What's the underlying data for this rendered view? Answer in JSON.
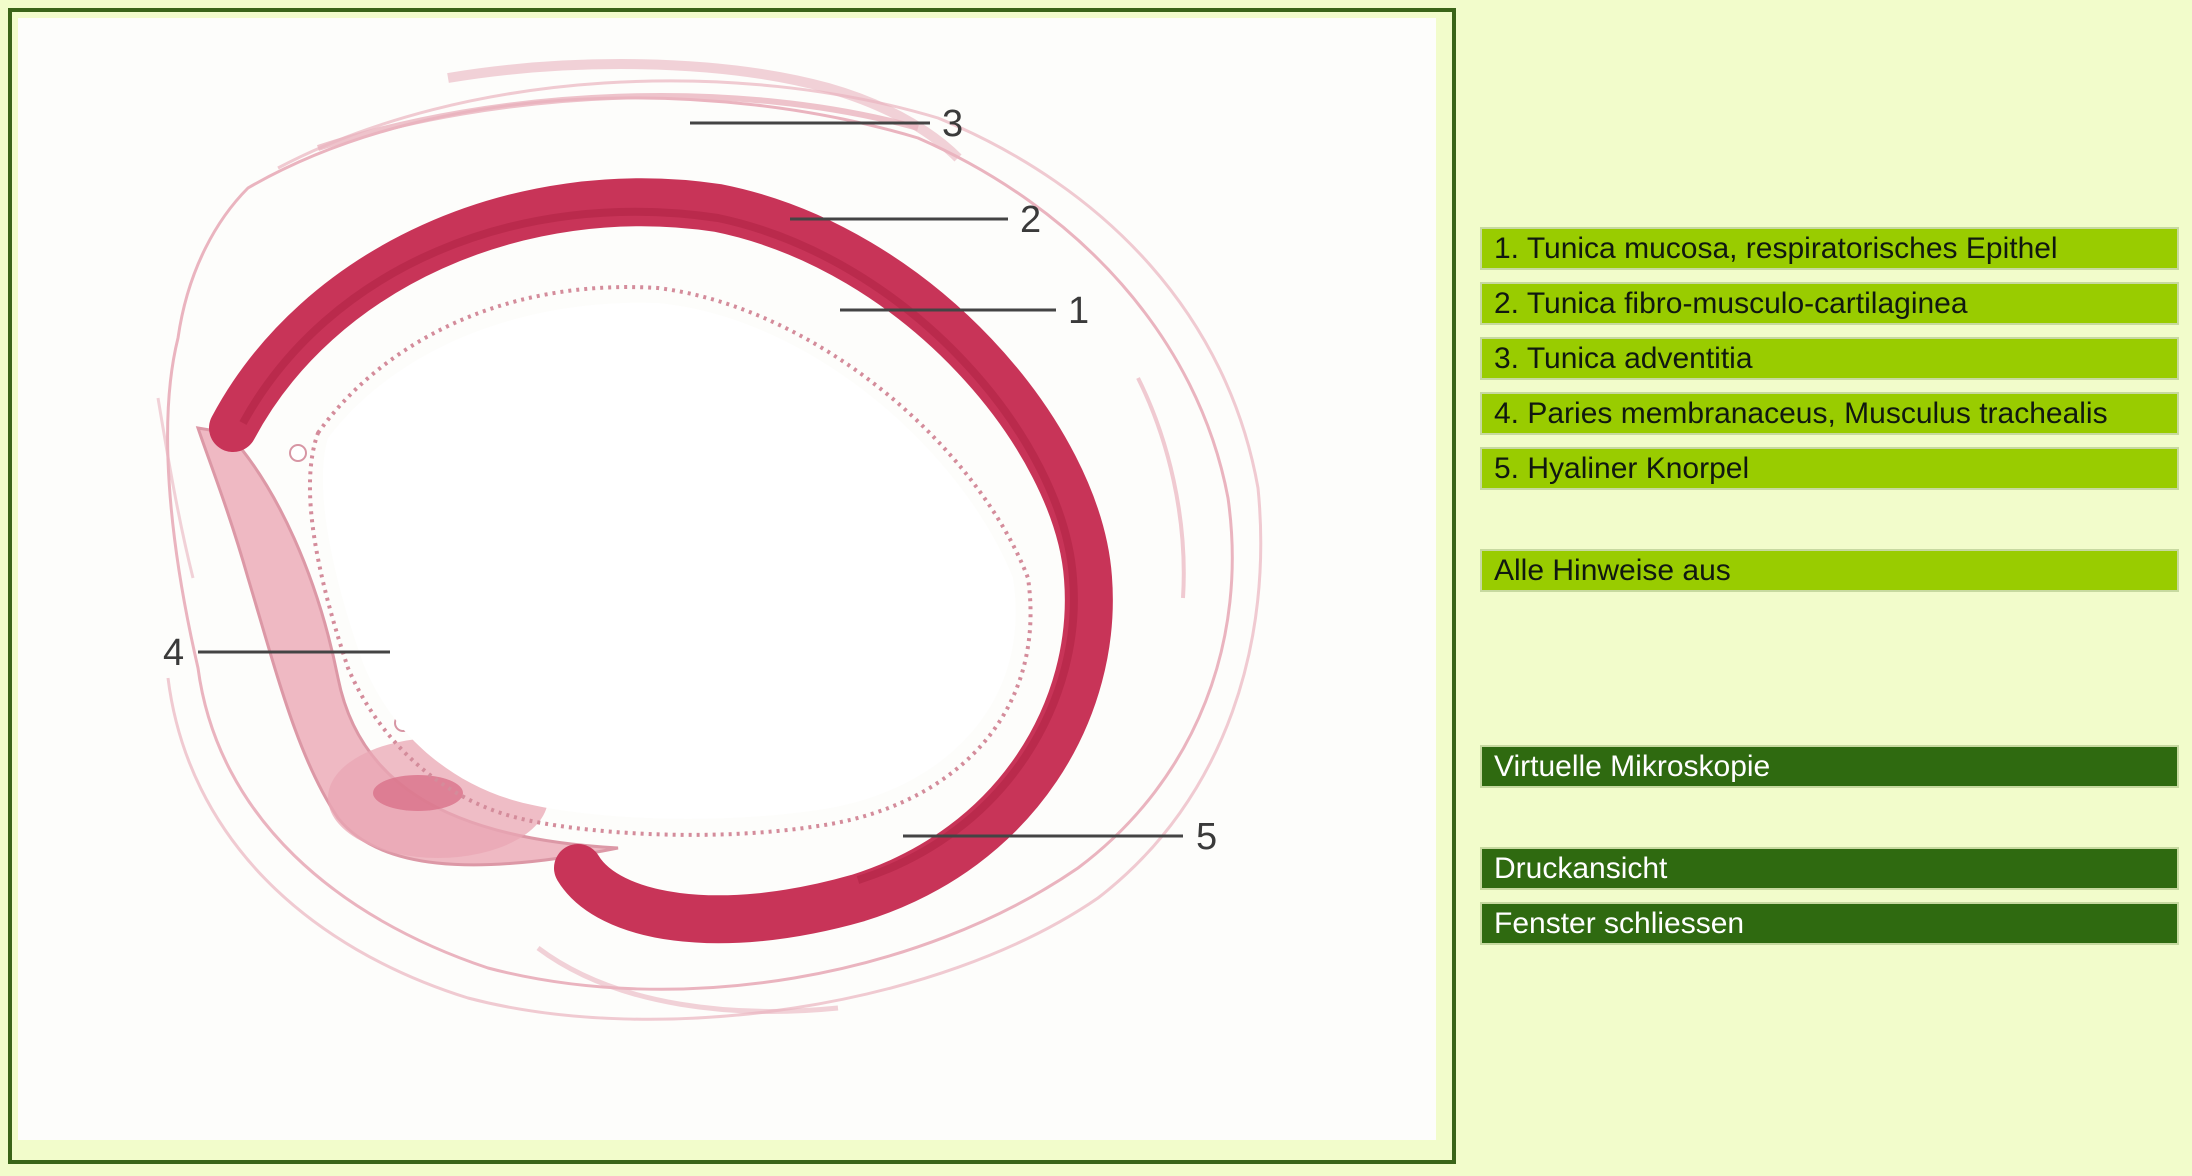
{
  "figure": {
    "labels": [
      "1",
      "2",
      "3",
      "4",
      "5"
    ]
  },
  "sidebar": {
    "legend": [
      "1. Tunica mucosa, respiratorisches Epithel",
      "2. Tunica fibro-musculo-cartilaginea",
      "3. Tunica adventitia",
      "4. Paries membranaceus, Musculus trachealis",
      "5. Hyaliner Knorpel"
    ],
    "toggle_all": "Alle Hinweise aus",
    "virtual": "Virtuelle Mikroskopie",
    "print": "Druckansicht",
    "close": "Fenster schliessen"
  },
  "colors": {
    "background": "#f2fccb",
    "frame_border": "#3a6418",
    "button_light": "#99cc00",
    "button_dark": "#2f6a10",
    "cartilage": "#c83458",
    "tissue": "#e9aab6"
  }
}
